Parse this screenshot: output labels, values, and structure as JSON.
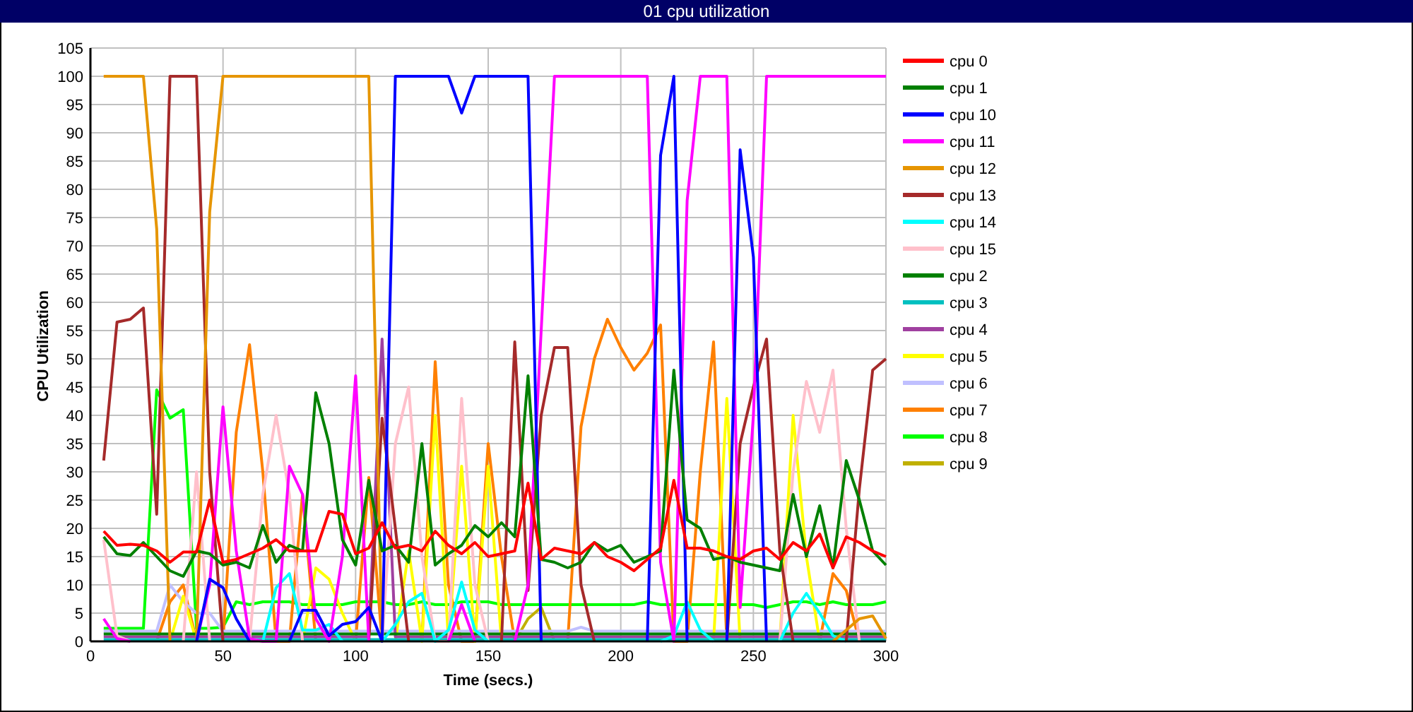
{
  "window": {
    "title": "01 cpu utilization"
  },
  "chart_data": {
    "type": "line",
    "xlabel": "Time (secs.)",
    "ylabel": "CPU Utilization",
    "xlim": [
      0,
      300
    ],
    "ylim": [
      0,
      105
    ],
    "grid": true,
    "legend": true,
    "xticks": [
      0,
      50,
      100,
      150,
      200,
      250,
      300
    ],
    "yticks": [
      0,
      5,
      10,
      15,
      20,
      25,
      30,
      35,
      40,
      45,
      50,
      55,
      60,
      65,
      70,
      75,
      80,
      85,
      90,
      95,
      100,
      105
    ],
    "x": [
      5,
      10,
      15,
      20,
      25,
      30,
      35,
      40,
      45,
      50,
      55,
      60,
      65,
      70,
      75,
      80,
      85,
      90,
      95,
      100,
      105,
      110,
      115,
      120,
      125,
      130,
      135,
      140,
      145,
      150,
      155,
      160,
      165,
      170,
      175,
      180,
      185,
      190,
      195,
      200,
      205,
      210,
      215,
      220,
      225,
      230,
      235,
      240,
      245,
      250,
      255,
      260,
      265,
      270,
      275,
      280,
      285,
      290,
      295,
      300
    ],
    "series": [
      {
        "name": "cpu 0",
        "color": "#ff0000",
        "values": [
          19.5,
          17,
          17.2,
          17,
          16,
          14,
          15.8,
          15.8,
          25,
          14,
          14.5,
          15.5,
          16.5,
          18,
          16,
          16,
          16,
          23,
          22.5,
          15.5,
          16.5,
          21,
          16.5,
          17,
          16,
          19.5,
          17,
          15.5,
          17.5,
          15,
          15.5,
          16,
          28,
          14.5,
          16.5,
          16,
          15.5,
          17.5,
          15,
          14,
          12.5,
          14.5,
          16.5,
          28.5,
          16.5,
          16.5,
          16,
          15,
          14.5,
          16,
          16.5,
          14.5,
          17.5,
          16,
          19,
          13,
          18.5,
          17.5,
          16,
          15
        ]
      },
      {
        "name": "cpu 1",
        "color": "#008000",
        "values": [
          18.5,
          15.5,
          15.2,
          17.5,
          15,
          12.5,
          11.5,
          16,
          15.5,
          13.5,
          14,
          13,
          20.5,
          14,
          17,
          16,
          44,
          35,
          18,
          13.5,
          28.5,
          16,
          17,
          14,
          35,
          13.5,
          15.5,
          17,
          20.5,
          18.5,
          21,
          18.5,
          47,
          14.5,
          14,
          13,
          14,
          17.5,
          16,
          17,
          14,
          15,
          16,
          48,
          21.5,
          20,
          14.5,
          15,
          14,
          13.5,
          13,
          12.5,
          26,
          15,
          24,
          13,
          32,
          25,
          16,
          13.5
        ]
      },
      {
        "name": "cpu 10",
        "color": "#0000ff",
        "values": [
          null,
          null,
          null,
          null,
          null,
          null,
          null,
          0,
          11,
          9.5,
          4,
          0,
          null,
          null,
          0,
          5.5,
          5.5,
          1,
          3,
          3.5,
          6,
          0,
          100,
          100,
          100,
          100,
          100,
          93.5,
          100,
          100,
          100,
          100,
          100,
          0,
          null,
          null,
          null,
          null,
          null,
          null,
          null,
          0,
          86,
          100,
          0,
          null,
          null,
          0,
          87,
          68,
          0,
          null,
          null,
          null,
          null,
          null,
          null,
          null,
          null,
          null
        ]
      },
      {
        "name": "cpu 11",
        "color": "#ff00ff",
        "values": [
          4,
          0.5,
          0,
          null,
          null,
          null,
          null,
          0,
          10,
          41.5,
          16,
          0.5,
          0,
          0,
          31,
          26,
          4,
          0,
          15,
          47,
          0,
          null,
          null,
          null,
          null,
          null,
          0,
          6.5,
          0,
          null,
          null,
          0,
          10,
          55,
          100,
          100,
          100,
          100,
          100,
          100,
          100,
          100,
          14,
          0,
          78,
          100,
          100,
          100,
          6,
          40,
          100,
          100,
          100,
          100,
          100,
          100,
          100,
          100,
          100,
          100
        ]
      },
      {
        "name": "cpu 12",
        "color": "#e69500",
        "values": [
          100,
          100,
          100,
          100,
          73,
          0,
          null,
          0,
          76,
          100,
          100,
          100,
          100,
          100,
          100,
          100,
          100,
          100,
          100,
          100,
          100,
          0,
          null,
          null,
          null,
          null,
          null,
          null,
          null,
          null,
          null,
          null,
          null,
          null,
          null,
          null,
          null,
          null,
          null,
          null,
          null,
          null,
          null,
          null,
          null,
          null,
          null,
          null,
          null,
          null,
          null,
          null,
          null,
          null,
          null,
          0,
          2,
          4,
          4.5,
          0.5
        ]
      },
      {
        "name": "cpu 13",
        "color": "#a52a2a",
        "values": [
          32,
          56.5,
          57,
          59,
          22.5,
          100,
          100,
          100,
          30,
          0,
          null,
          null,
          null,
          null,
          null,
          null,
          null,
          null,
          null,
          null,
          0,
          39.5,
          20,
          0,
          null,
          null,
          null,
          null,
          null,
          null,
          0,
          53,
          9,
          40,
          52,
          52,
          10,
          0,
          null,
          null,
          null,
          null,
          null,
          null,
          null,
          null,
          null,
          0,
          35,
          45,
          53.5,
          16,
          0,
          null,
          null,
          null,
          0,
          27,
          48,
          50
        ]
      },
      {
        "name": "cpu 14",
        "color": "#00ffff",
        "values": [
          null,
          null,
          null,
          null,
          null,
          null,
          null,
          null,
          null,
          null,
          null,
          null,
          0,
          9.5,
          12,
          2,
          2,
          3,
          0,
          null,
          null,
          0,
          3,
          7,
          8.5,
          0,
          2,
          10.5,
          2,
          0,
          null,
          null,
          null,
          null,
          null,
          null,
          null,
          null,
          null,
          null,
          null,
          null,
          0,
          1,
          7,
          2,
          0,
          null,
          null,
          null,
          null,
          0,
          5,
          8.5,
          5,
          1,
          0,
          null,
          null,
          null
        ]
      },
      {
        "name": "cpu 15",
        "color": "#ffc0cb",
        "values": [
          18,
          1,
          0,
          null,
          null,
          null,
          0,
          30,
          0,
          null,
          null,
          0,
          26,
          40,
          26,
          0,
          null,
          null,
          null,
          null,
          null,
          0,
          35,
          45,
          15,
          0,
          0,
          43,
          10,
          0,
          null,
          null,
          null,
          null,
          null,
          null,
          null,
          null,
          null,
          null,
          null,
          null,
          null,
          null,
          null,
          null,
          null,
          null,
          null,
          null,
          null,
          0,
          30,
          46,
          37,
          48,
          20,
          0,
          null,
          null
        ]
      },
      {
        "name": "cpu 2",
        "color": "#008000",
        "values": [
          1.3,
          1.3,
          1.3,
          1.3,
          1.3,
          1.3,
          1.3,
          1.3,
          1.3,
          1.3,
          1.3,
          1.3,
          1.3,
          1.3,
          1.3,
          1.3,
          1.3,
          1.3,
          1.3,
          1.3,
          1.3,
          1.3,
          1.3,
          1.3,
          1.3,
          1.3,
          1.3,
          1.3,
          1.3,
          1.3,
          1.3,
          1.3,
          1.3,
          1.3,
          1.3,
          1.3,
          1.3,
          1.3,
          1.3,
          1.3,
          1.3,
          1.3,
          1.3,
          1.3,
          1.3,
          1.3,
          1.3,
          1.3,
          1.3,
          1.3,
          1.3,
          1.3,
          1.3,
          1.3,
          1.3,
          1.3,
          1.3,
          1.3,
          1.3,
          1.3
        ]
      },
      {
        "name": "cpu 3",
        "color": "#00c0c0",
        "values": [
          0.3,
          0.3,
          0.3,
          0.3,
          0.3,
          0.3,
          0.3,
          0.3,
          0.3,
          0.3,
          0.3,
          0.3,
          0.3,
          0.3,
          0.3,
          0.3,
          0.3,
          0.3,
          0.3,
          0.3,
          0.3,
          0.3,
          0.3,
          0.3,
          0.3,
          0.3,
          0.3,
          0.3,
          0.3,
          0.3,
          0.3,
          0.3,
          0.3,
          0.3,
          0.3,
          0.3,
          0.3,
          0.3,
          0.3,
          0.3,
          0.3,
          0.3,
          0.3,
          0.3,
          0.3,
          0.3,
          0.3,
          0.3,
          0.3,
          0.3,
          0.3,
          0.3,
          0.3,
          0.3,
          0.3,
          0.3,
          0.3,
          0.3,
          0.3,
          0.3
        ]
      },
      {
        "name": "cpu 4",
        "color": "#a040a0",
        "values": [
          0.8,
          0.8,
          0.8,
          0.8,
          0.8,
          0.8,
          0.8,
          0.8,
          0.8,
          0.8,
          0.8,
          0.8,
          0.8,
          0.8,
          0.8,
          0.8,
          0.8,
          0.8,
          0.8,
          0.8,
          0.8,
          53.5,
          0.8,
          0.8,
          0.8,
          0.8,
          0.8,
          0.8,
          0.8,
          0.8,
          0.8,
          0.8,
          0.8,
          0.8,
          0.8,
          0.8,
          0.8,
          0.8,
          0.8,
          0.8,
          0.8,
          0.8,
          0.8,
          0.8,
          0.8,
          0.8,
          0.8,
          0.8,
          0.8,
          0.8,
          0.8,
          0.8,
          0.8,
          0.8,
          0.8,
          0.8,
          0.8,
          0.8,
          0.8,
          0.8
        ]
      },
      {
        "name": "cpu 5",
        "color": "#ffff00",
        "values": [
          null,
          null,
          null,
          null,
          null,
          0,
          8,
          0,
          null,
          null,
          null,
          null,
          null,
          null,
          null,
          0,
          13,
          11,
          5,
          0,
          null,
          null,
          0,
          16,
          0,
          40,
          0,
          31,
          0,
          31,
          0,
          null,
          null,
          null,
          null,
          null,
          null,
          null,
          null,
          null,
          null,
          null,
          null,
          null,
          null,
          null,
          0,
          43,
          0,
          null,
          null,
          0,
          40,
          15,
          0,
          null,
          null,
          null,
          null,
          null
        ]
      },
      {
        "name": "cpu 6",
        "color": "#c0c0ff",
        "values": [
          1.8,
          1.8,
          1.8,
          1.8,
          1.8,
          10,
          7,
          5,
          5,
          1.8,
          1.8,
          1.8,
          1.8,
          1.8,
          1.8,
          1.8,
          1.8,
          1.8,
          1.8,
          1.8,
          1.8,
          1.8,
          1.8,
          1.8,
          1.8,
          1.8,
          1.8,
          1.8,
          1.8,
          1.8,
          1.8,
          1.8,
          1.8,
          1.8,
          1.8,
          1.8,
          2.5,
          1.8,
          1.8,
          1.8,
          1.8,
          1.8,
          1.8,
          1.8,
          1.8,
          1.8,
          1.8,
          1.8,
          1.8,
          1.8,
          1.8,
          1.8,
          1.8,
          1.8,
          1.8,
          1.8,
          1.8,
          1.8,
          1.8,
          1.8
        ]
      },
      {
        "name": "cpu 7",
        "color": "#ff8000",
        "values": [
          null,
          null,
          null,
          null,
          0,
          7,
          10,
          0,
          null,
          0,
          37,
          52.5,
          30,
          0,
          0,
          26,
          0,
          null,
          null,
          0,
          29,
          0,
          null,
          null,
          0,
          49.5,
          10,
          0,
          0,
          35,
          15,
          0,
          null,
          null,
          null,
          0,
          38,
          50,
          57,
          52,
          48,
          51,
          56,
          0,
          0,
          30,
          53,
          0,
          null,
          null,
          null,
          null,
          null,
          null,
          0,
          12,
          9,
          0,
          null,
          null
        ]
      },
      {
        "name": "cpu 8",
        "color": "#00ff00",
        "values": [
          2.3,
          2.3,
          2.3,
          2.3,
          44.5,
          39.5,
          41,
          2.3,
          2.3,
          2.5,
          7,
          6.5,
          7,
          7,
          7,
          6.5,
          6.5,
          6.5,
          6.5,
          7,
          7,
          7,
          6.5,
          6.5,
          7,
          6.5,
          6.5,
          7,
          7,
          7,
          6.5,
          6.5,
          6.5,
          6.5,
          6.5,
          6.5,
          6.5,
          6.5,
          6.5,
          6.5,
          6.5,
          7,
          6.5,
          6.5,
          6.5,
          6.5,
          6.5,
          6.5,
          6.5,
          6.5,
          6,
          6.5,
          7,
          7,
          6.5,
          7,
          6.5,
          6.5,
          6.5,
          7
        ]
      },
      {
        "name": "cpu 9",
        "color": "#c0b000",
        "values": [
          null,
          null,
          null,
          null,
          null,
          null,
          null,
          null,
          null,
          null,
          null,
          null,
          null,
          null,
          null,
          null,
          null,
          null,
          null,
          null,
          null,
          null,
          null,
          null,
          null,
          null,
          null,
          null,
          null,
          null,
          null,
          0,
          4,
          6,
          0,
          null,
          null,
          null,
          null,
          null,
          null,
          null,
          null,
          null,
          null,
          null,
          null,
          null,
          null,
          null,
          null,
          null,
          null,
          null,
          null,
          null,
          null,
          null,
          null,
          null
        ]
      }
    ]
  }
}
